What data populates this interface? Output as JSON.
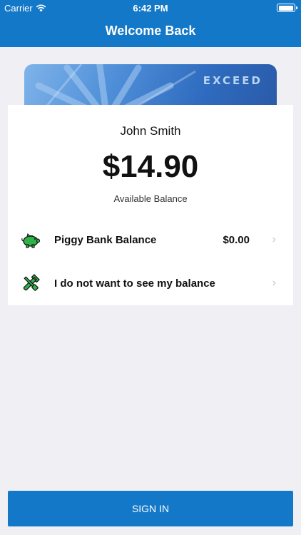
{
  "status_bar": {
    "carrier": "Carrier",
    "time": "6:42 PM"
  },
  "header": {
    "title": "Welcome Back"
  },
  "card": {
    "brand": "EXCEED"
  },
  "account": {
    "name": "John Smith",
    "balance": "$14.90",
    "balance_label": "Available Balance"
  },
  "rows": [
    {
      "label": "Piggy Bank Balance",
      "value": "$0.00",
      "icon": "piggy-bank-icon"
    },
    {
      "label": "I do not want to see my balance",
      "icon": "tools-icon"
    }
  ],
  "footer": {
    "signin_label": "SIGN IN"
  },
  "colors": {
    "primary": "#1478c8",
    "background": "#efeff4",
    "icon_green": "#2fb24a"
  }
}
